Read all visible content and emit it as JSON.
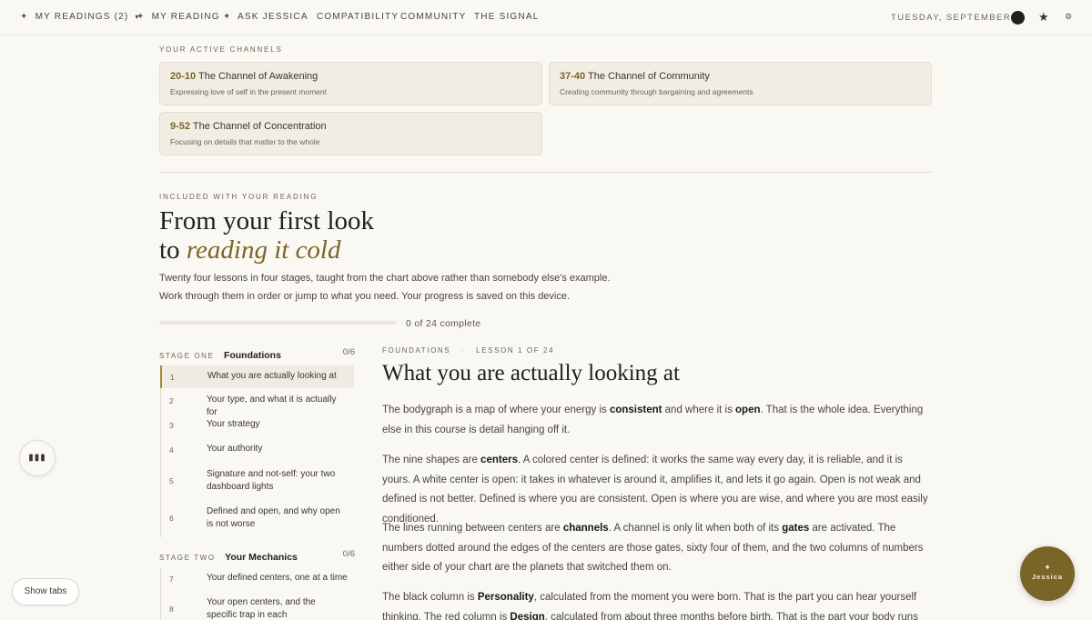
{
  "nav": {
    "items": [
      {
        "label": "My Readings (2)",
        "star": "✦",
        "caret": "▾"
      },
      {
        "label": "My Reading",
        "star": "✦"
      },
      {
        "label": "Ask Jessica",
        "star": "✦"
      },
      {
        "label": "Compatibility"
      },
      {
        "label": "Community"
      },
      {
        "label": "The Signal"
      }
    ],
    "date": "Tuesday, September 1",
    "star_icon": "★",
    "gear_icon": "⚙"
  },
  "channels": {
    "label": "Your active channels",
    "cards": [
      {
        "code": "20-10",
        "name": "The Channel of Awakening",
        "desc": "Expressing love of self in the present moment"
      },
      {
        "code": "37-40",
        "name": "The Channel of Community",
        "desc": "Creating community through bargaining and agreements"
      },
      {
        "code": "9-52",
        "name": "The Channel of Concentration",
        "desc": "Focusing on details that matter to the whole"
      }
    ]
  },
  "course": {
    "label": "Included with your reading",
    "headline_line1": "From your first look",
    "headline_to": "to",
    "headline_em": "reading it cold",
    "intro": "Twenty four lessons in four stages, taught from the chart above rather than somebody else's example. Work through them in order or jump to what you need. Your progress is saved on this device.",
    "progress": 0,
    "progress_text": "0 of 24 complete"
  },
  "stages": [
    {
      "label": "Stage One",
      "name": "Foundations",
      "count": "0/6",
      "lessons": [
        {
          "num": "1",
          "title": "What you are actually looking at"
        },
        {
          "num": "2",
          "title": "Your type, and what it is actually for"
        },
        {
          "num": "3",
          "title": "Your strategy"
        },
        {
          "num": "4",
          "title": "Your authority"
        },
        {
          "num": "5",
          "title": "Signature and not-self: your two dashboard lights"
        },
        {
          "num": "6",
          "title": "Defined and open, and why open is not worse"
        }
      ]
    },
    {
      "label": "Stage Two",
      "name": "Your Mechanics",
      "count": "0/6",
      "lessons": [
        {
          "num": "7",
          "title": "Your defined centers, one at a time"
        },
        {
          "num": "8",
          "title": "Your open centers, and the specific trap in each"
        }
      ]
    }
  ],
  "article": {
    "kicker_stage": "Foundations",
    "kicker_sep": "·",
    "kicker_lesson": "Lesson 1 of 24",
    "title": "What you are actually looking at",
    "p1": [
      "The bodygraph is a map of where your energy is ",
      "consistent",
      " and where it is ",
      "open",
      ". That is the whole idea. Everything else in this course is detail hanging off it."
    ],
    "p2": [
      "The nine shapes are ",
      "centers",
      ". A colored center is defined: it works the same way every day, it is reliable, and it is yours. A white center is open: it takes in whatever is around it, amplifies it, and lets it go again. Open is not weak and defined is not better. Defined is where you are consistent. Open is where you are wise, and where you are most easily conditioned."
    ],
    "p3": [
      "The lines running between centers are ",
      "channels",
      ". A channel is only lit when both of its ",
      "gates",
      " are activated. The numbers dotted around the edges of the centers are those gates, sixty four of them, and the two columns of numbers either side of your chart are the planets that switched them on."
    ],
    "p4": [
      "The black column is ",
      "Personality",
      ", calculated from the moment you were born. That is the part you can hear yourself thinking. The red column is ",
      "Design",
      ", calculated from about three months before birth. That is the part your body runs without asking."
    ]
  },
  "ui": {
    "float_icon": "▮▮▮",
    "show_tabs": "Show tabs",
    "fab_star": "✦",
    "fab_label": "Jessica"
  }
}
